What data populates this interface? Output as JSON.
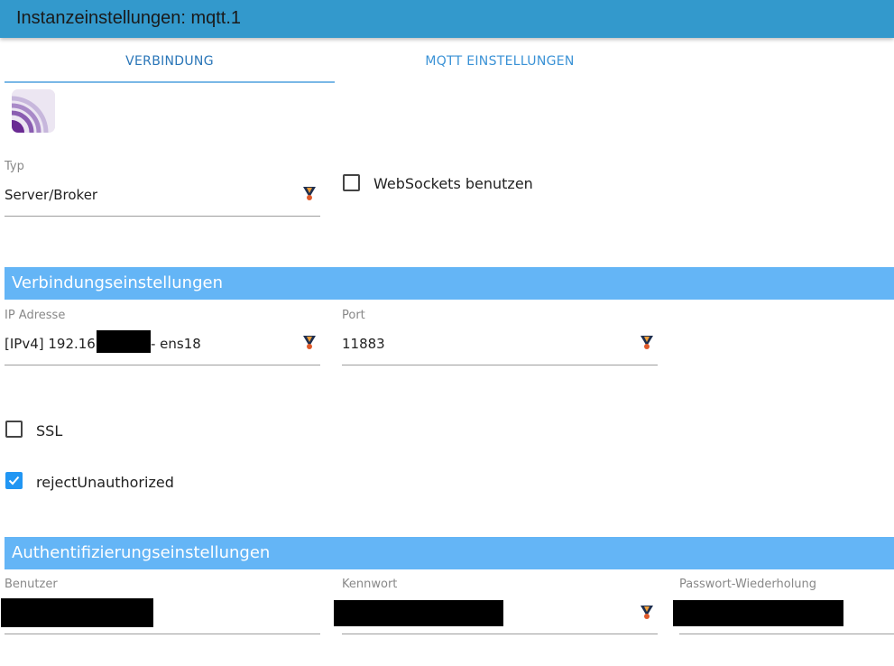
{
  "window": {
    "title": "Instanzeinstellungen: mqtt.1"
  },
  "tabs": [
    {
      "label": "VERBINDUNG",
      "active": true
    },
    {
      "label": "MQTT EINSTELLUNGEN",
      "active": false
    }
  ],
  "connection": {
    "type_label": "Typ",
    "type_value": "Server/Broker",
    "websockets_label": "WebSockets benutzen",
    "websockets_checked": false
  },
  "sections": {
    "connection_settings": "Verbindungseinstellungen",
    "auth_settings": "Authentifizierungseinstellungen"
  },
  "network": {
    "ip_label": "IP Adresse",
    "ip_value_prefix": "[IPv4] 192.168.",
    "ip_value_suffix": "- ens18",
    "port_label": "Port",
    "port_value": "11883"
  },
  "options": {
    "ssl_label": "SSL",
    "ssl_checked": false,
    "reject_label": "rejectUnauthorized",
    "reject_checked": true
  },
  "auth": {
    "user_label": "Benutzer",
    "password_label": "Kennwort",
    "password_repeat_label": "Passwort-Wiederholung"
  },
  "colors": {
    "titlebar": "#3399cc",
    "section_header": "#64b5f6",
    "tab_active": "#2a76b8",
    "checkbox_checked": "#2196f3"
  },
  "icons": {
    "logo": "mqtt-logo-icon",
    "field_helper": "iobroker-icon",
    "check": "checkmark-icon"
  }
}
